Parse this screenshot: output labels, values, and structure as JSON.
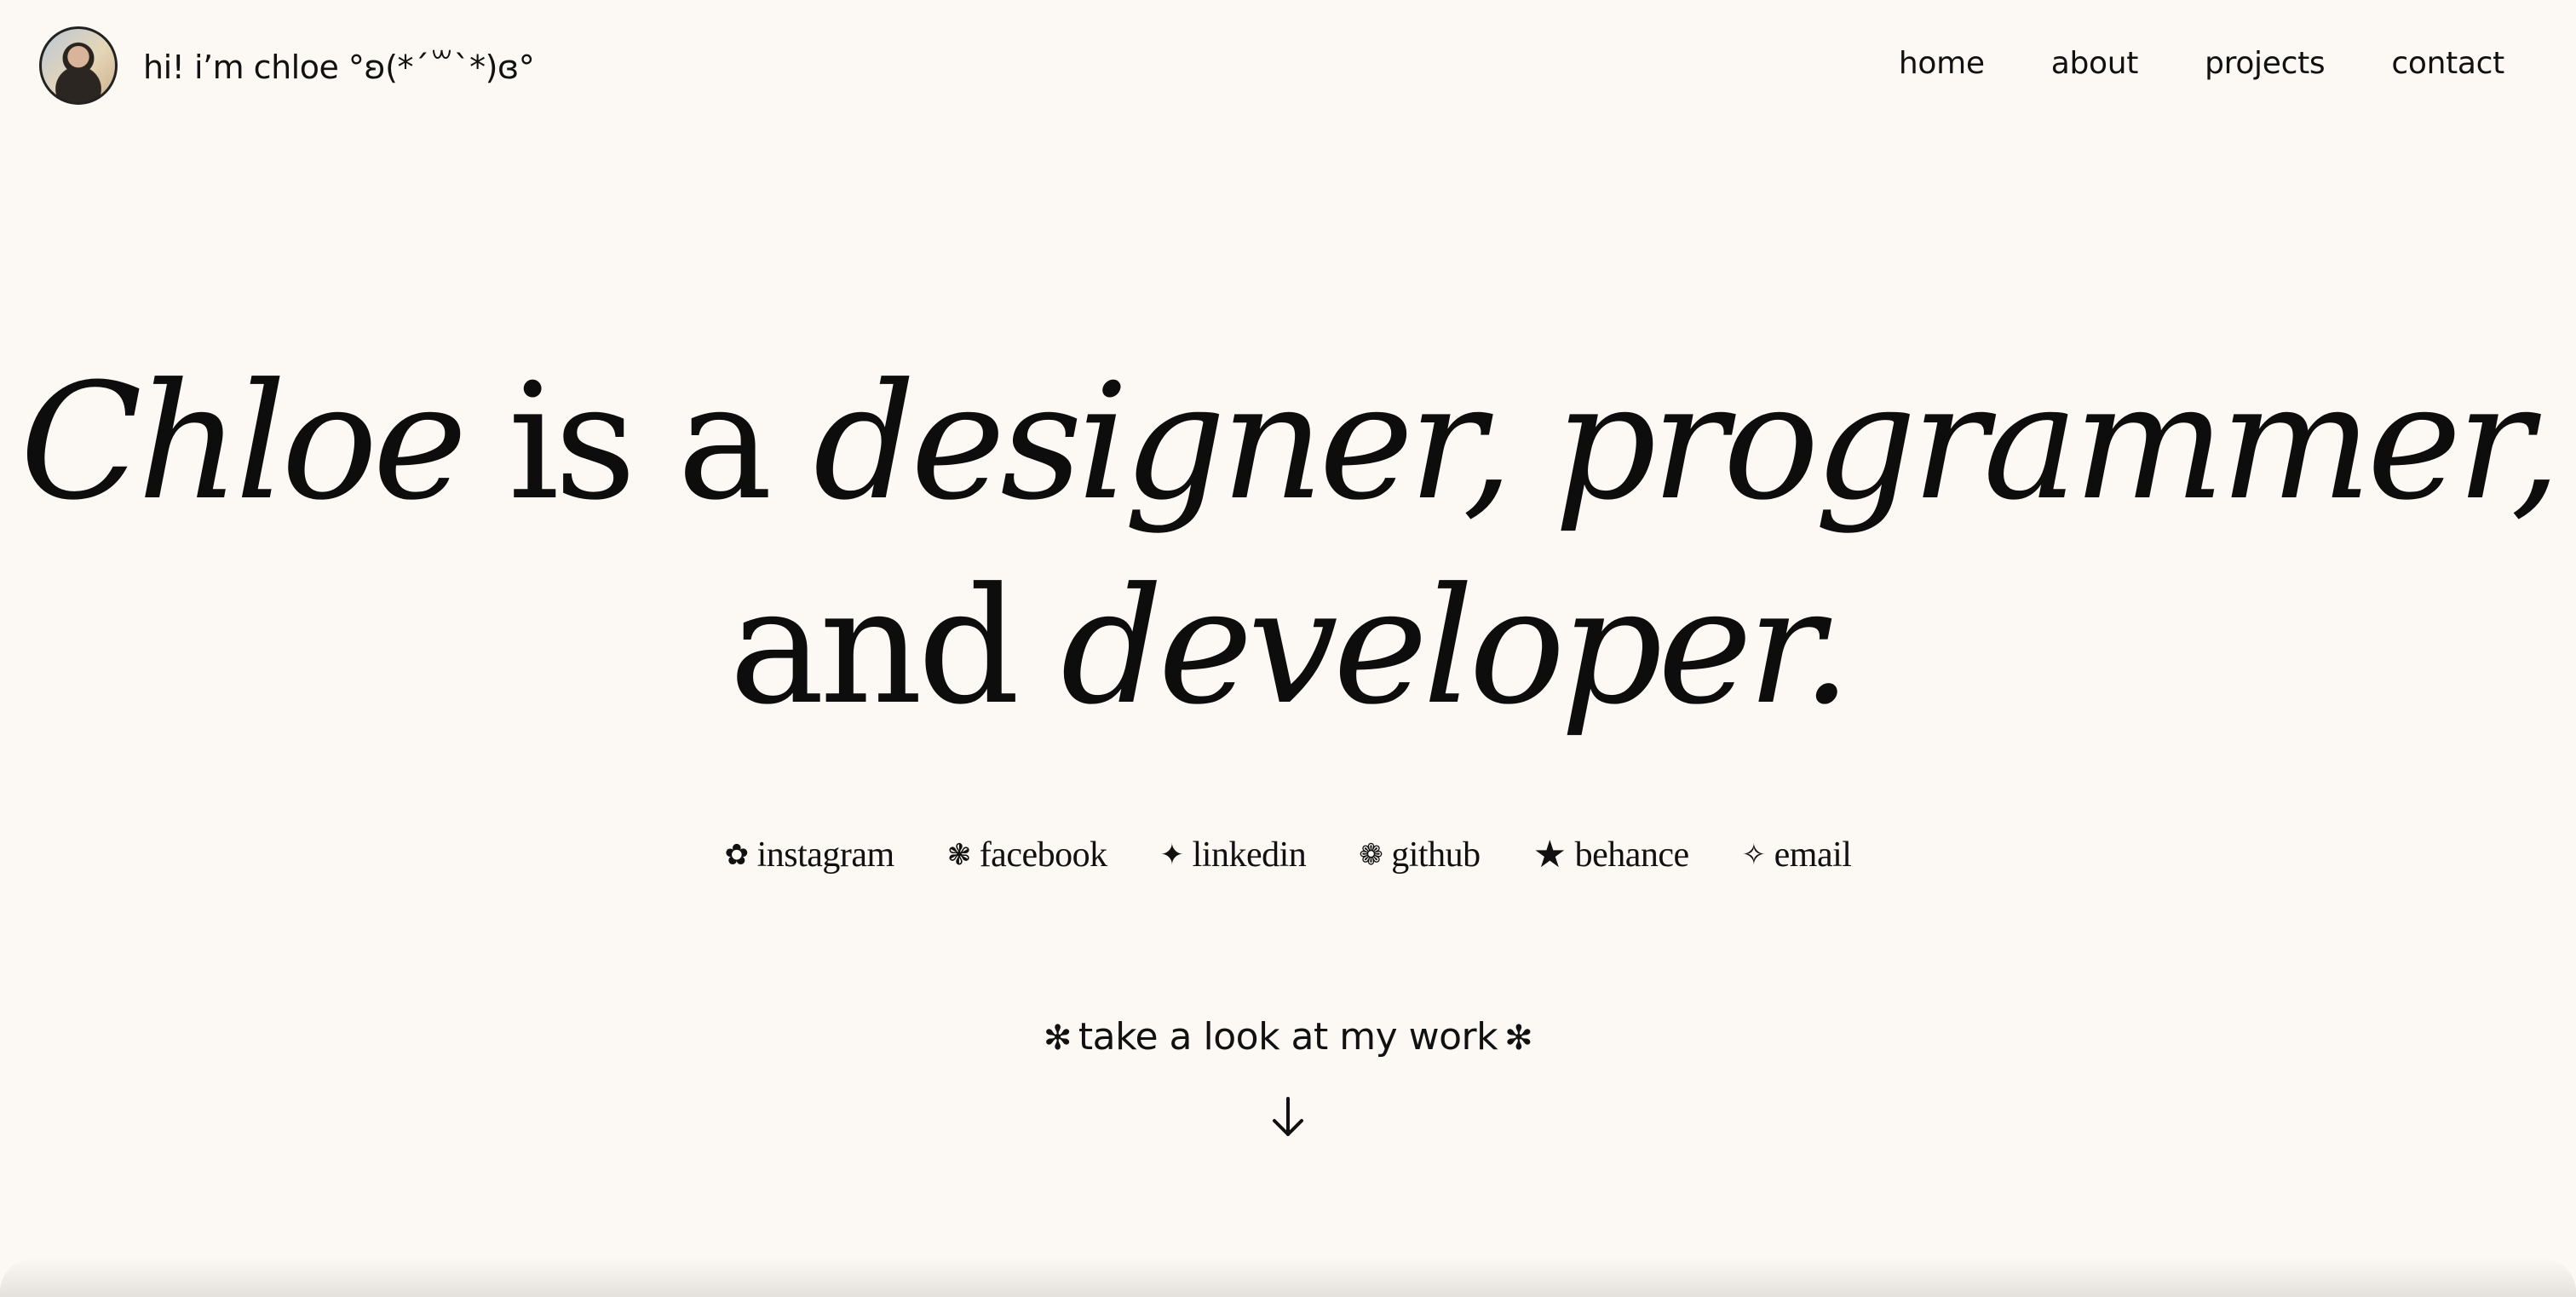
{
  "header": {
    "avatar_alt": "Chloe",
    "brand_text": "hi! i’m chloe °ʚ(*´꒳`*)ɞ°",
    "nav": [
      {
        "label": "home"
      },
      {
        "label": "about"
      },
      {
        "label": "projects"
      },
      {
        "label": "contact"
      }
    ]
  },
  "hero": {
    "line1": {
      "name": "Chloe",
      "connector": " is a ",
      "roles": "designer, programmer,"
    },
    "line2": {
      "connector": "and ",
      "role": "developer."
    }
  },
  "socials": [
    {
      "icon": "flower-icon",
      "glyph": "✿",
      "label": "instagram"
    },
    {
      "icon": "snowflake-icon",
      "glyph": "❃",
      "label": "facebook"
    },
    {
      "icon": "four-point-star-icon",
      "glyph": "✦",
      "label": "linkedin"
    },
    {
      "icon": "gear-flower-icon",
      "glyph": "❁",
      "label": "github"
    },
    {
      "icon": "star-icon",
      "glyph": "★",
      "label": "behance"
    },
    {
      "icon": "sparkle-outline-icon",
      "glyph": "✧",
      "label": "email"
    }
  ],
  "cta": {
    "star_left": "✻",
    "text": "take a look at my work",
    "star_right": "✻"
  },
  "colors": {
    "background": "#fcf8f3",
    "text": "#111111"
  }
}
